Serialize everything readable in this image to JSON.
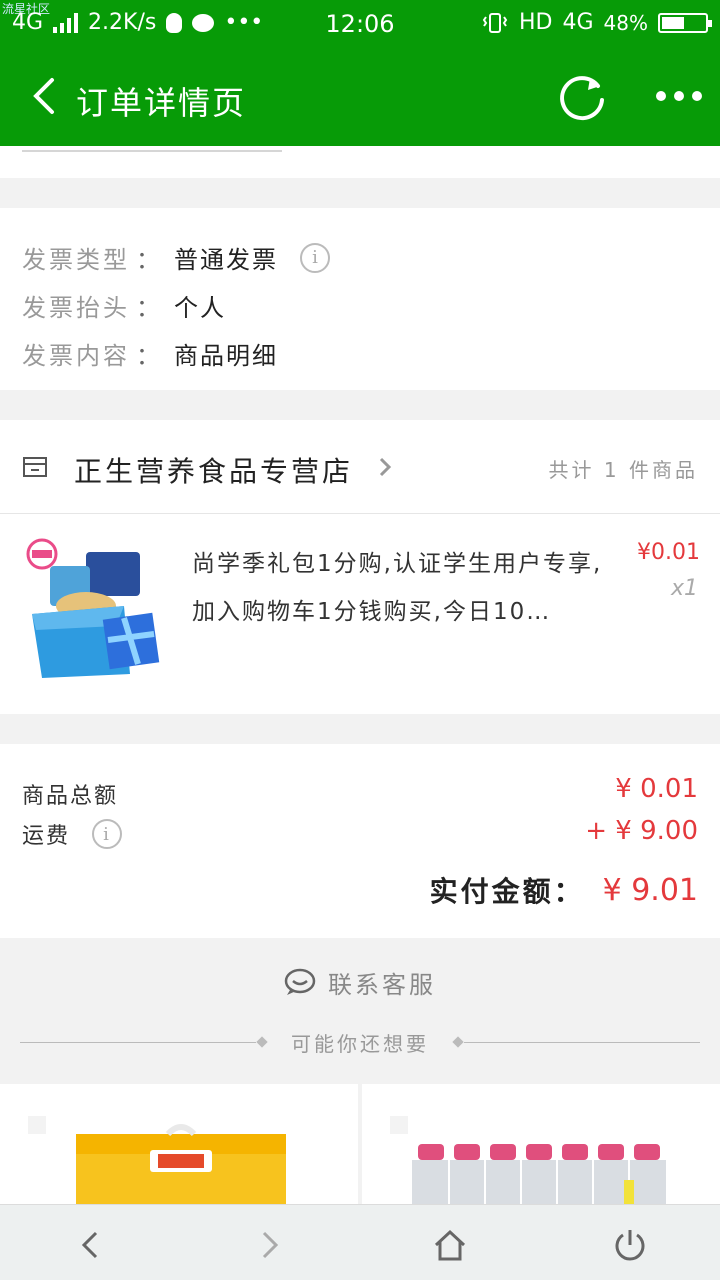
{
  "status_bar": {
    "watermark": "流星社区",
    "network": "4G",
    "speed": "2.2K/s",
    "time": "12:06",
    "hd": "HD",
    "network2": "4G",
    "battery": "48%"
  },
  "nav": {
    "title": "订单详情页"
  },
  "invoice": {
    "type_label": "发票类型",
    "type_value": "普通发票",
    "header_label": "发票抬头",
    "header_value": "个人",
    "content_label": "发票内容",
    "content_value": "商品明细",
    "separator": "："
  },
  "store": {
    "name": "正生营养食品专营店",
    "count_text": "共计 1 件商品"
  },
  "product": {
    "title": "尚学季礼包1分购,认证学生用户专享,加入购物车1分钱购买,今日10…",
    "price": "¥0.01",
    "qty": "x1"
  },
  "summary": {
    "goods_label": "商品总额",
    "goods_value": "¥ 0.01",
    "freight_label": "运费",
    "freight_value": "+ ¥ 9.00",
    "total_label": "实付金额：",
    "total_value": "¥ 9.01"
  },
  "contact": {
    "label": "联系客服"
  },
  "recommend": {
    "label": "可能你还想要"
  },
  "colors": {
    "brand_green": "#079b07",
    "price_red": "#e4393c"
  }
}
